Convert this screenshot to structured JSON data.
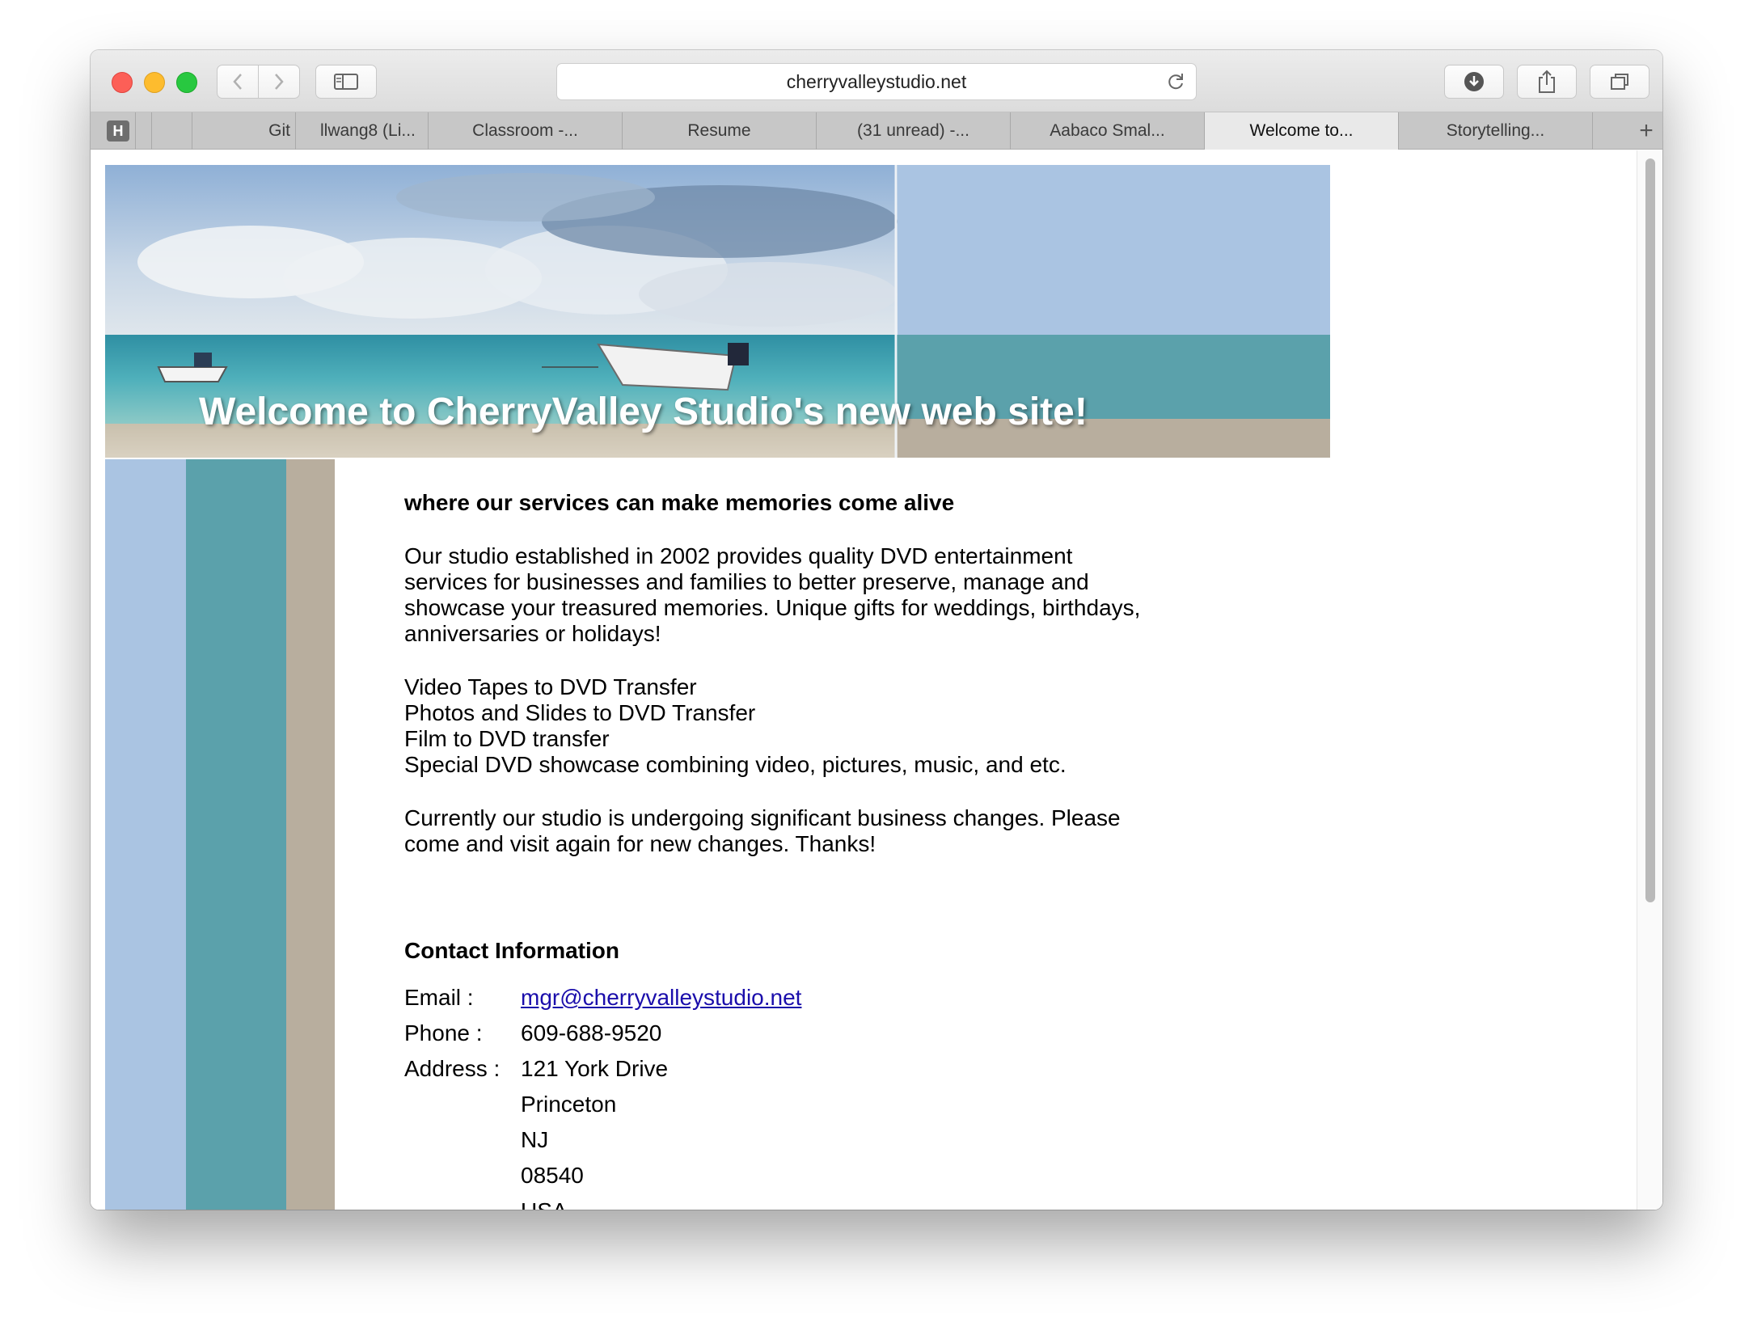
{
  "browser": {
    "url": "cherryvalleystudio.net",
    "tabs": [
      {
        "label": "Git"
      },
      {
        "label": "llwang8 (Li..."
      },
      {
        "label": "Classroom -..."
      },
      {
        "label": "Resume"
      },
      {
        "label": "(31 unread) -..."
      },
      {
        "label": "Aabaco Smal..."
      },
      {
        "label": "Welcome to..."
      },
      {
        "label": "Storytelling..."
      }
    ],
    "favicon_letter": "H",
    "new_tab_label": "+"
  },
  "banner": {
    "title": "Welcome to CherryValley Studio's new web site!"
  },
  "main": {
    "tagline": "where our services can make memories come alive",
    "intro": "Our studio established in 2002 provides quality DVD entertainment\nservices for businesses and families to better preserve, manage and\nshowcase your treasured memories.  Unique gifts for weddings, birthdays,\nanniversaries or holidays!",
    "services": [
      "Video Tapes to DVD Transfer",
      "Photos and Slides to DVD Transfer",
      "Film to DVD transfer",
      "Special DVD showcase combining video, pictures, music, and etc."
    ],
    "notice": "Currently our studio is undergoing significant business changes.  Please\ncome and visit again for new changes.  Thanks!"
  },
  "contact": {
    "title": "Contact Information",
    "email_label": "Email :",
    "email": "mgr@cherryvalleystudio.net",
    "phone_label": "Phone :",
    "phone": "609-688-9520",
    "address_label": "Address :",
    "address_lines": [
      "121 York Drive",
      "Princeton",
      "NJ",
      "08540",
      "USA"
    ]
  },
  "colors": {
    "stripe_blue": "#aac4e2",
    "stripe_teal": "#5ba1ab",
    "stripe_tan": "#b8ae9e",
    "link": "#1a0dab"
  }
}
